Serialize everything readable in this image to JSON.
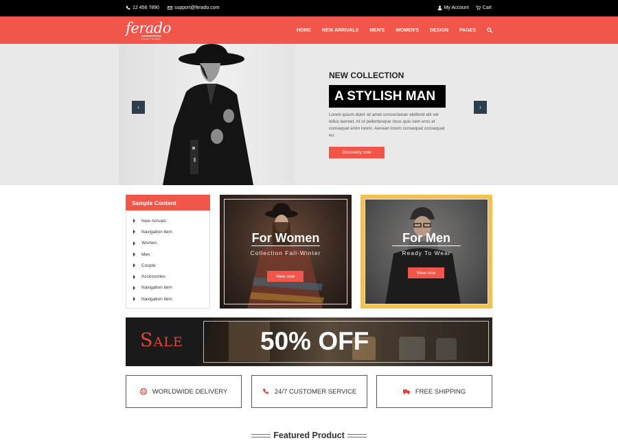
{
  "topbar": {
    "phone": "12 456 7890",
    "email": "support@ferado.com",
    "account_label": "My Account",
    "cart_label": "Cart"
  },
  "header": {
    "logo_text": "ferado",
    "logo_sub": "CLOTHING",
    "nav": [
      "HOME",
      "NEW ARRIVALS",
      "MEN'S",
      "WOMEN'S",
      "DESIGN",
      "PAGES"
    ]
  },
  "hero": {
    "kicker": "NEW COLLECTION",
    "title": "A STYLISH MAN",
    "description": "Lorem ipsum dolor sit amet consectetuer eleifend elit vel tellus laoreet. At ut pellentesque risus quis sem eros et consequat enim lorem. Aenean lorem consequat consequat eu.",
    "button_label": "Discovery now",
    "prev_label": "‹",
    "next_label": "›"
  },
  "sidebar": {
    "title": "Sample Content",
    "items": [
      "New Arrivals",
      "Navigation item",
      "Women",
      "Men",
      "Couple",
      "Accessories",
      "Navigation item",
      "Navigation item"
    ]
  },
  "promos": {
    "women": {
      "title": "For Women",
      "subtitle": "Collection Fall-Winter",
      "button": "View now"
    },
    "men": {
      "title": "For Men",
      "subtitle": "Ready To Wear",
      "button": "View now"
    }
  },
  "sale": {
    "word": "Sale",
    "offer": "50% OFF"
  },
  "features": [
    {
      "label": "WORLDWIDE DELIVERY",
      "icon": "lifebuoy-icon"
    },
    {
      "label": "24/7 CUSTOMER SERVICE",
      "icon": "phone-icon"
    },
    {
      "label": "FREE SHIPPING",
      "icon": "truck-icon"
    }
  ],
  "featured": {
    "title": "Featured Product"
  },
  "colors": {
    "accent": "#f2554a",
    "dark": "#000000",
    "slider_arrow": "#2f3e4d"
  }
}
